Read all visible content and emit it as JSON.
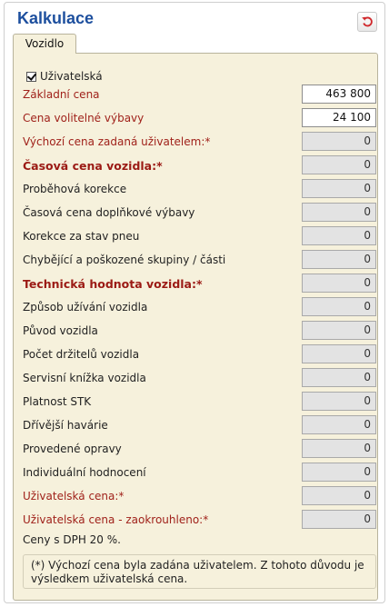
{
  "header": {
    "title": "Kalkulace",
    "reset_icon": "undo-arrow-icon"
  },
  "tabs": [
    {
      "label": "Vozidlo"
    }
  ],
  "user_checkbox": {
    "label": "Uživatelská",
    "checked": true
  },
  "rows": [
    {
      "label": "Základní cena",
      "value": "463 800",
      "style": "red",
      "editable": true
    },
    {
      "label": "Cena volitelné výbavy",
      "value": "24 100",
      "style": "red",
      "editable": true
    },
    {
      "label": "Výchozí cena zadaná uživatelem:*",
      "value": "0",
      "style": "red",
      "editable": false
    },
    {
      "label": "Časová cena vozidla:*",
      "value": "0",
      "style": "bold",
      "editable": false
    },
    {
      "label": "Proběhová korekce",
      "value": "0",
      "style": "normal",
      "editable": false
    },
    {
      "label": "Časová cena doplňkové výbavy",
      "value": "0",
      "style": "normal",
      "editable": false
    },
    {
      "label": "Korekce za stav pneu",
      "value": "0",
      "style": "normal",
      "editable": false
    },
    {
      "label": "Chybějící a poškozené skupiny / části",
      "value": "0",
      "style": "normal",
      "editable": false
    },
    {
      "label": "Technická hodnota vozidla:*",
      "value": "0",
      "style": "bold",
      "editable": false
    },
    {
      "label": "Způsob užívání vozidla",
      "value": "0",
      "style": "normal",
      "editable": false
    },
    {
      "label": "Původ vozidla",
      "value": "0",
      "style": "normal",
      "editable": false
    },
    {
      "label": "Počet držitelů vozidla",
      "value": "0",
      "style": "normal",
      "editable": false
    },
    {
      "label": "Servisní knížka vozidla",
      "value": "0",
      "style": "normal",
      "editable": false
    },
    {
      "label": "Platnost STK",
      "value": "0",
      "style": "normal",
      "editable": false
    },
    {
      "label": "Dřívější havárie",
      "value": "0",
      "style": "normal",
      "editable": false
    },
    {
      "label": "Provedené opravy",
      "value": "0",
      "style": "normal",
      "editable": false
    },
    {
      "label": "Individuální hodnocení",
      "value": "0",
      "style": "normal",
      "editable": false
    },
    {
      "label": "Uživatelská cena:*",
      "value": "0",
      "style": "red",
      "editable": false
    },
    {
      "label": "Uživatelská cena - zaokrouhleno:*",
      "value": "0",
      "style": "red",
      "editable": false
    }
  ],
  "vat_note": "Ceny s DPH 20 %.",
  "footnote": "(*) Výchozí cena byla zadána uživatelem. Z tohoto důvodu je výsledkem uživatelská cena.",
  "colors": {
    "title": "#1d4f9e",
    "label_red": "#a0221b",
    "panel_bg": "#f6f1dc",
    "reset_icon": "#d0282c"
  }
}
